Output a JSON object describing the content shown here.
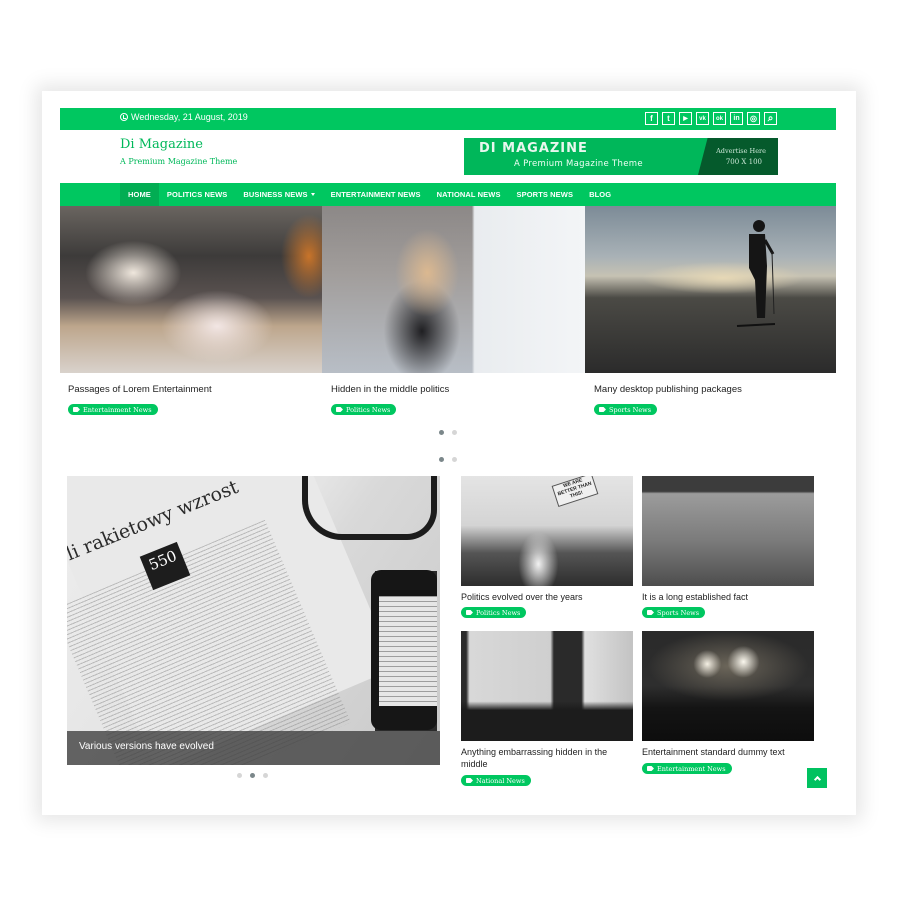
{
  "topbar": {
    "date": "Wednesday, 21 August, 2019",
    "social_icons": [
      {
        "name": "facebook-icon",
        "glyph": "f"
      },
      {
        "name": "twitter-icon",
        "glyph": "t"
      },
      {
        "name": "youtube-icon",
        "glyph": "▶"
      },
      {
        "name": "vk-icon",
        "glyph": "vk"
      },
      {
        "name": "odnoklassniki-icon",
        "glyph": "ok"
      },
      {
        "name": "linkedin-icon",
        "glyph": "in"
      },
      {
        "name": "instagram-icon",
        "glyph": "◎"
      },
      {
        "name": "search-icon",
        "glyph": "⌕"
      }
    ]
  },
  "header": {
    "site_title": "Di Magazine",
    "tagline": "A Premium Magazine Theme",
    "ad": {
      "title": "DI MAGAZINE",
      "subtitle": "A Premium Magazine Theme",
      "right_line1": "Advertise Here",
      "right_line2": "700 X 100"
    }
  },
  "nav": {
    "items": [
      {
        "label": "HOME",
        "active": true
      },
      {
        "label": "POLITICS NEWS"
      },
      {
        "label": "BUSINESS NEWS",
        "dropdown": true
      },
      {
        "label": "ENTERTAINMENT NEWS"
      },
      {
        "label": "NATIONAL NEWS"
      },
      {
        "label": "SPORTS NEWS"
      },
      {
        "label": "BLOG"
      }
    ]
  },
  "featured_slider": {
    "slides": [
      {
        "title": "Passages of Lorem Entertainment",
        "category": "Entertainment News"
      },
      {
        "title": "Hidden in the middle politics",
        "category": "Politics News"
      },
      {
        "title": "Many desktop publishing packages",
        "category": "Sports News"
      }
    ],
    "pagination_upper": {
      "count": 2,
      "active": 0
    },
    "pagination_lower": {
      "count": 2,
      "active": 0
    }
  },
  "main_slider": {
    "caption": "Various versions have evolved",
    "image_text": {
      "headline": "li rakietowy wzrost",
      "badge": "550"
    },
    "pagination": {
      "count": 3,
      "active": 1
    }
  },
  "grid": {
    "cards": [
      {
        "title": "Politics evolved over the years",
        "category": "Politics News",
        "image_sign": "WE ARE BETTER THAN THIS!"
      },
      {
        "title": "It is a long established fact",
        "category": "Sports News"
      },
      {
        "title": "Anything embarrassing hidden in the middle",
        "category": "National News"
      },
      {
        "title": "Entertainment standard dummy text",
        "category": "Entertainment News"
      }
    ]
  },
  "colors": {
    "brand_green": "#00c760",
    "nav_active": "#02ad53",
    "ad_dark": "#055a2c"
  }
}
